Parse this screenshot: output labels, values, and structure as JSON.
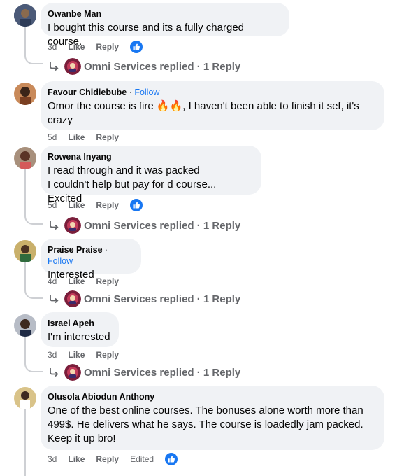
{
  "comments": [
    {
      "author": "Owanbe Man",
      "follow": "",
      "text_lines": [
        "I bought this course and its a fully charged course."
      ],
      "time": "3d",
      "like": "Like",
      "reply": "Reply",
      "edited": "",
      "has_reaction": true
    },
    {
      "author": "Favour Chidiebube",
      "follow": "Follow",
      "text_lines": [
        "Omor the course is fire 🔥🔥, I haven't been able to finish it sef, it's",
        "crazy"
      ],
      "time": "5d",
      "like": "Like",
      "reply": "Reply",
      "edited": "",
      "has_reaction": false
    },
    {
      "author": "Rowena Inyang",
      "follow": "",
      "text_lines": [
        "I read through and it was packed",
        "I couldn't help but pay for d course... Excited"
      ],
      "time": "5d",
      "like": "Like",
      "reply": "Reply",
      "edited": "",
      "has_reaction": true
    },
    {
      "author": "Praise Praise",
      "follow": "Follow",
      "text_lines": [
        "Interested"
      ],
      "time": "4d",
      "like": "Like",
      "reply": "Reply",
      "edited": "",
      "has_reaction": false
    },
    {
      "author": "Israel Apeh",
      "follow": "",
      "text_lines": [
        "I'm interested"
      ],
      "time": "3d",
      "like": "Like",
      "reply": "Reply",
      "edited": "",
      "has_reaction": false
    },
    {
      "author": "Olusola Abiodun Anthony",
      "follow": "",
      "text_lines": [
        "One of the best online courses. The bonuses alone worth more than",
        "499$. He delivers what he says. The course is loadedly jam packed.",
        "Keep it up bro!"
      ],
      "time": "3d",
      "like": "Like",
      "reply": "Reply",
      "edited": "Edited",
      "has_reaction": true
    }
  ],
  "reply_summaries": [
    {
      "text": "Omni Services replied · 1 Reply"
    },
    {
      "text": "Omni Services replied · 1 Reply"
    },
    {
      "text": "Omni Services replied · 1 Reply"
    },
    {
      "text": "Omni Services replied · 1 Reply"
    }
  ],
  "follow_separator": " · ",
  "icons": {
    "reaction": "like-thumb-icon",
    "reply_arrow": "reply-arrow-icon"
  },
  "colors": {
    "bubble": "#f0f2f5",
    "accent": "#1877f2",
    "muted": "#65676b",
    "thread": "#ced0d4"
  }
}
